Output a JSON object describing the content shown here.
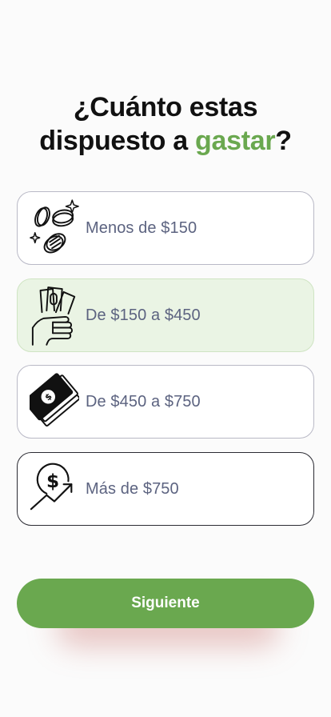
{
  "header": {
    "title_prefix": "¿Cuánto estas",
    "title_line2": "dispuesto a ",
    "title_accent": "gastar",
    "title_suffix": "?"
  },
  "options": [
    {
      "label": "Menos de $150",
      "icon": "coins-sparkle-icon",
      "state": "default"
    },
    {
      "label": "De $150 a $450",
      "icon": "hand-holding-cash-icon",
      "state": "selected"
    },
    {
      "label": "De $450 a $750",
      "icon": "banknotes-stack-icon",
      "state": "default"
    },
    {
      "label": "Más de $750",
      "icon": "dollar-growth-arrow-icon",
      "state": "default"
    }
  ],
  "footer": {
    "next_label": "Siguiente"
  },
  "colors": {
    "accent": "#6aa84f",
    "selected_bg": "#eaf4e4",
    "option_text": "#5c6380",
    "title_text": "#111111"
  }
}
